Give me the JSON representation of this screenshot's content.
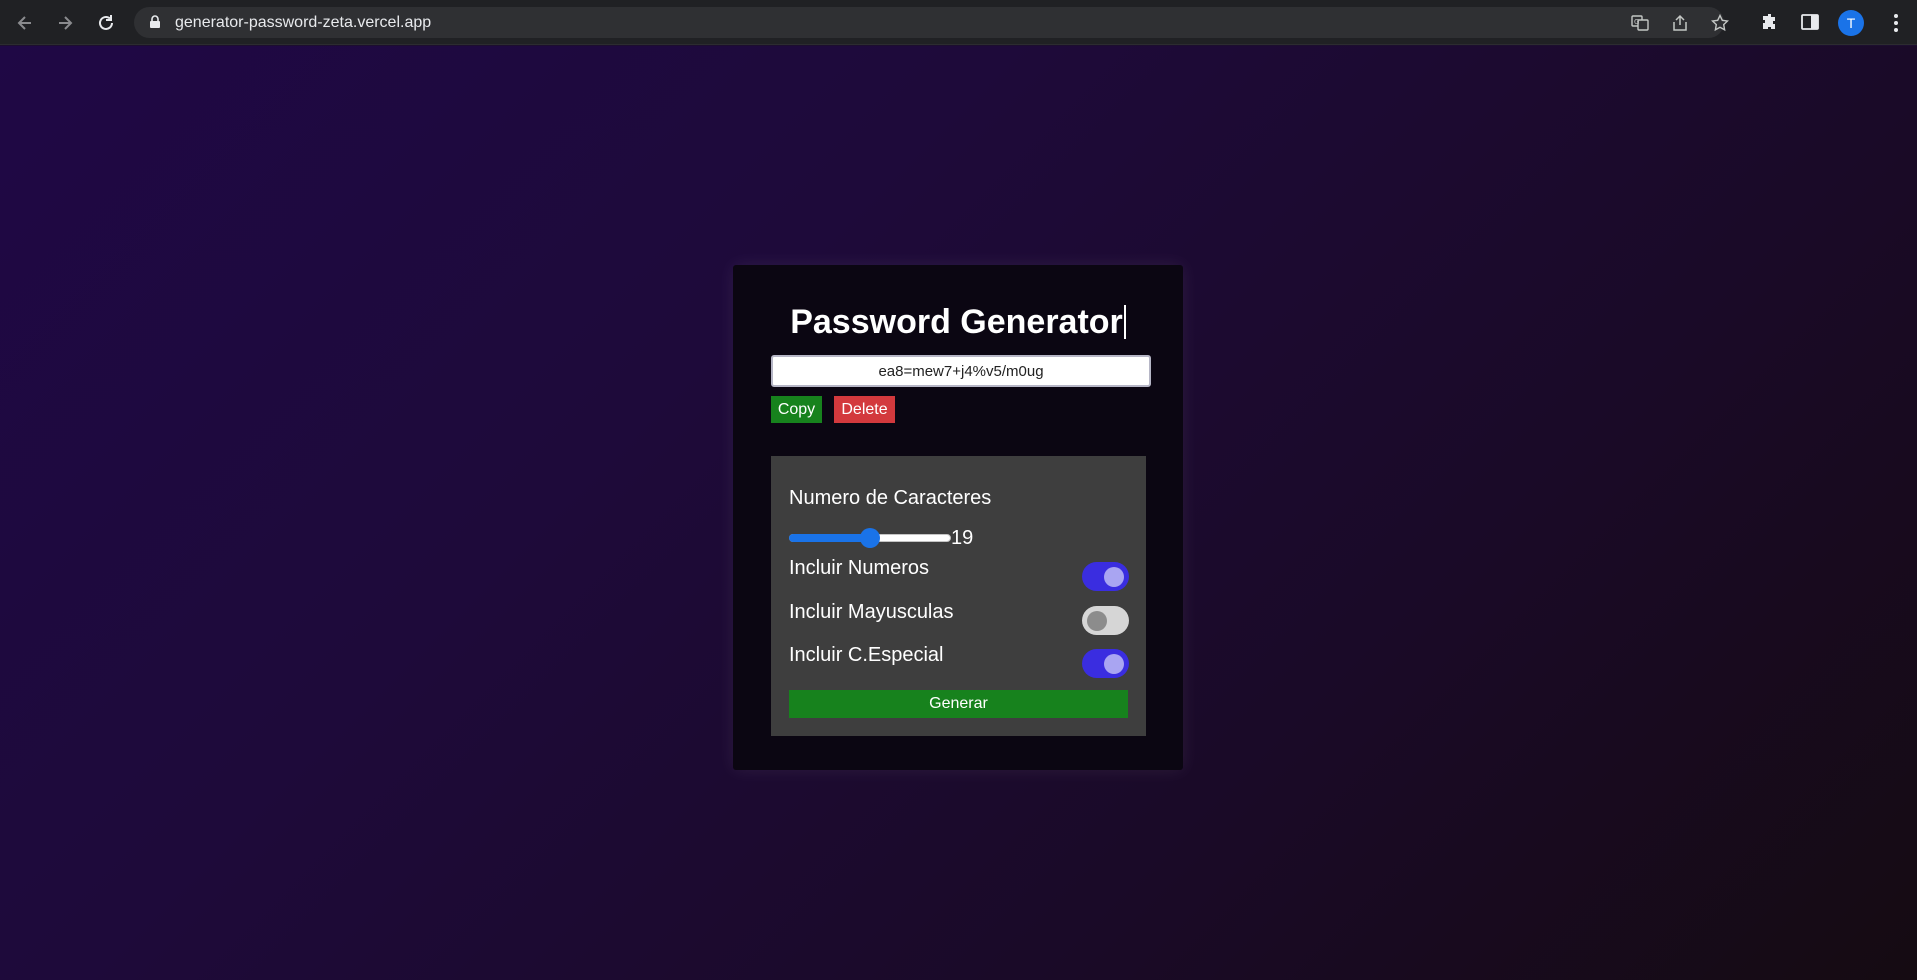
{
  "browser": {
    "url": "generator-password-zeta.vercel.app",
    "profile_initial": "T",
    "icons": [
      "back-icon",
      "forward-icon",
      "reload-icon",
      "lock-icon",
      "translate-icon",
      "share-icon",
      "bookmark-star-icon",
      "extensions-icon",
      "side-panel-icon"
    ]
  },
  "app": {
    "title": "Password Generator",
    "password": "ea8=mew7+j4%v5/m0ug",
    "copy_label": "Copy",
    "delete_label": "Delete",
    "length_label": "Numero de Caracteres",
    "length_value": "19",
    "length_fraction": 0.5,
    "options": [
      {
        "label": "Incluir Numeros",
        "enabled": true
      },
      {
        "label": "Incluir Mayusculas",
        "enabled": false
      },
      {
        "label": "Incluir C.Especial",
        "enabled": true
      }
    ],
    "generate_label": "Generar"
  },
  "colors": {
    "accent_green": "#17821d",
    "delete_red": "#d3393d",
    "toggle_on": "#3a2de0",
    "slider_blue": "#1a73e8"
  }
}
